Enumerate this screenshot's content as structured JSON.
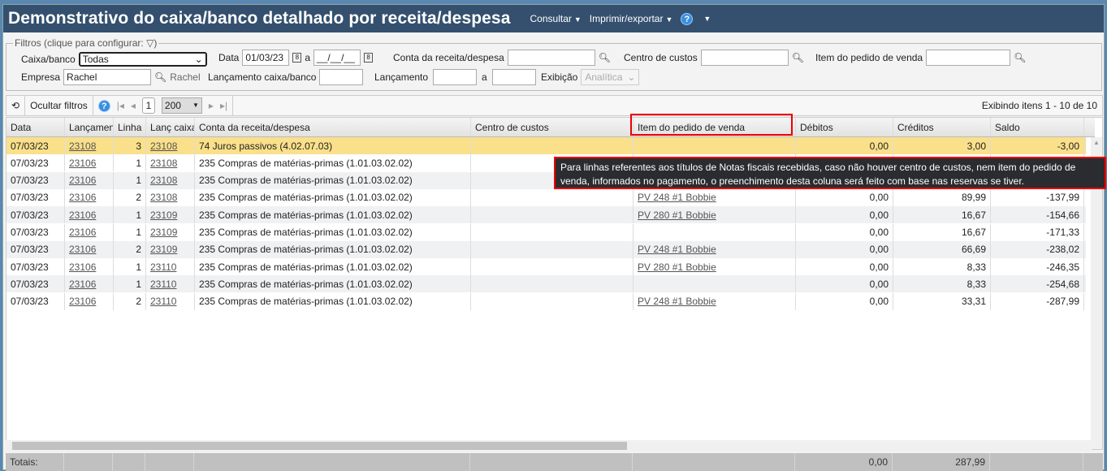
{
  "header": {
    "title": "Demonstrativo do caixa/banco detalhado por receita/despesa",
    "menu": [
      "Consultar",
      "Imprimir/exportar"
    ],
    "help": "?"
  },
  "filters": {
    "legend": "Filtros (clique para configurar:",
    "legend_end": ")",
    "caixa_label": "Caixa/banco",
    "caixa_value": "Todas",
    "data_label": "Data",
    "data_from": "01/03/23",
    "data_a": "a",
    "data_to": "__/__/__",
    "conta_label": "Conta da receita/despesa",
    "centro_label": "Centro de custos",
    "item_label": "Item do pedido de venda",
    "empresa_label": "Empresa",
    "empresa_value": "Rachel",
    "empresa_desc": "Rachel",
    "lanc_caixa_label": "Lançamento caixa/banco",
    "lanc_label": "Lançamento",
    "lanc_a": "a",
    "exib_label": "Exibição",
    "exib_value": "Analítica"
  },
  "toolbar": {
    "hide_filters": "Ocultar filtros",
    "page": "1",
    "page_size": "200",
    "status": "Exibindo itens 1 - 10 de 10"
  },
  "columns": [
    "Data",
    "Lançamento",
    "Linha",
    "Lanç caixa",
    "Conta da receita/despesa",
    "Centro de custos",
    "Item do pedido de venda",
    "Débitos",
    "Créditos",
    "Saldo"
  ],
  "rows": [
    [
      "07/03/23",
      "23108",
      "3",
      "23108",
      "74 Juros passivos (4.02.07.03)",
      "",
      "",
      "0,00",
      "3,00",
      "-3,00"
    ],
    [
      "07/03/23",
      "23106",
      "1",
      "23108",
      "235 Compras de matérias-primas (1.01.03.02.02)",
      "",
      "",
      "",
      "",
      ""
    ],
    [
      "07/03/23",
      "23106",
      "1",
      "23108",
      "235 Compras de matérias-primas (1.01.03.02.02)",
      "",
      "",
      "",
      "",
      ""
    ],
    [
      "07/03/23",
      "23106",
      "2",
      "23108",
      "235 Compras de matérias-primas (1.01.03.02.02)",
      "",
      "PV 248 #1 Bobbie",
      "0,00",
      "89,99",
      "-137,99"
    ],
    [
      "07/03/23",
      "23106",
      "1",
      "23109",
      "235 Compras de matérias-primas (1.01.03.02.02)",
      "",
      "PV 280 #1 Bobbie",
      "0,00",
      "16,67",
      "-154,66"
    ],
    [
      "07/03/23",
      "23106",
      "1",
      "23109",
      "235 Compras de matérias-primas (1.01.03.02.02)",
      "",
      "",
      "0,00",
      "16,67",
      "-171,33"
    ],
    [
      "07/03/23",
      "23106",
      "2",
      "23109",
      "235 Compras de matérias-primas (1.01.03.02.02)",
      "",
      "PV 248 #1 Bobbie",
      "0,00",
      "66,69",
      "-238,02"
    ],
    [
      "07/03/23",
      "23106",
      "1",
      "23110",
      "235 Compras de matérias-primas (1.01.03.02.02)",
      "",
      "PV 280 #1 Bobbie",
      "0,00",
      "8,33",
      "-246,35"
    ],
    [
      "07/03/23",
      "23106",
      "1",
      "23110",
      "235 Compras de matérias-primas (1.01.03.02.02)",
      "",
      "",
      "0,00",
      "8,33",
      "-254,68"
    ],
    [
      "07/03/23",
      "23106",
      "2",
      "23110",
      "235 Compras de matérias-primas (1.01.03.02.02)",
      "",
      "PV 248 #1 Bobbie",
      "0,00",
      "33,31",
      "-287,99"
    ]
  ],
  "tooltip": "Para linhas referentes aos títulos de Notas fiscais recebidas, caso não houver centro de custos, nem item do pedido de venda, informados no pagamento, o preenchimento desta coluna será feito com base nas reservas se tiver.",
  "totals": {
    "label": "Totais:",
    "debitos": "0,00",
    "creditos": "287,99"
  }
}
